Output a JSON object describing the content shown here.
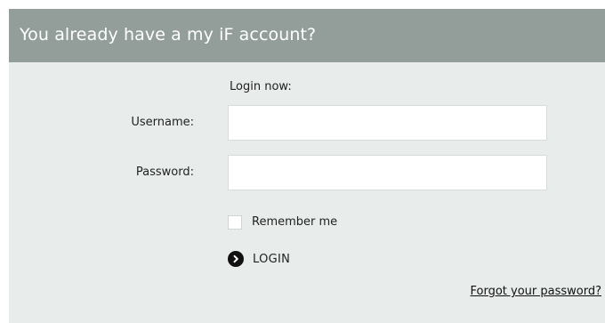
{
  "header": {
    "title": "You already have a my iF account?"
  },
  "form": {
    "intro": "Login now:",
    "username_label": "Username:",
    "username_value": "",
    "password_label": "Password:",
    "password_value": "",
    "remember_label": "Remember me",
    "remember_checked": false,
    "login_label": "LOGIN",
    "forgot_link": "Forgot your password?"
  },
  "icons": {
    "login": "chevron-right-circle-icon"
  },
  "colors": {
    "header_bg": "#939e9a",
    "panel_bg": "#e8ecea",
    "header_text": "#ffffff"
  }
}
